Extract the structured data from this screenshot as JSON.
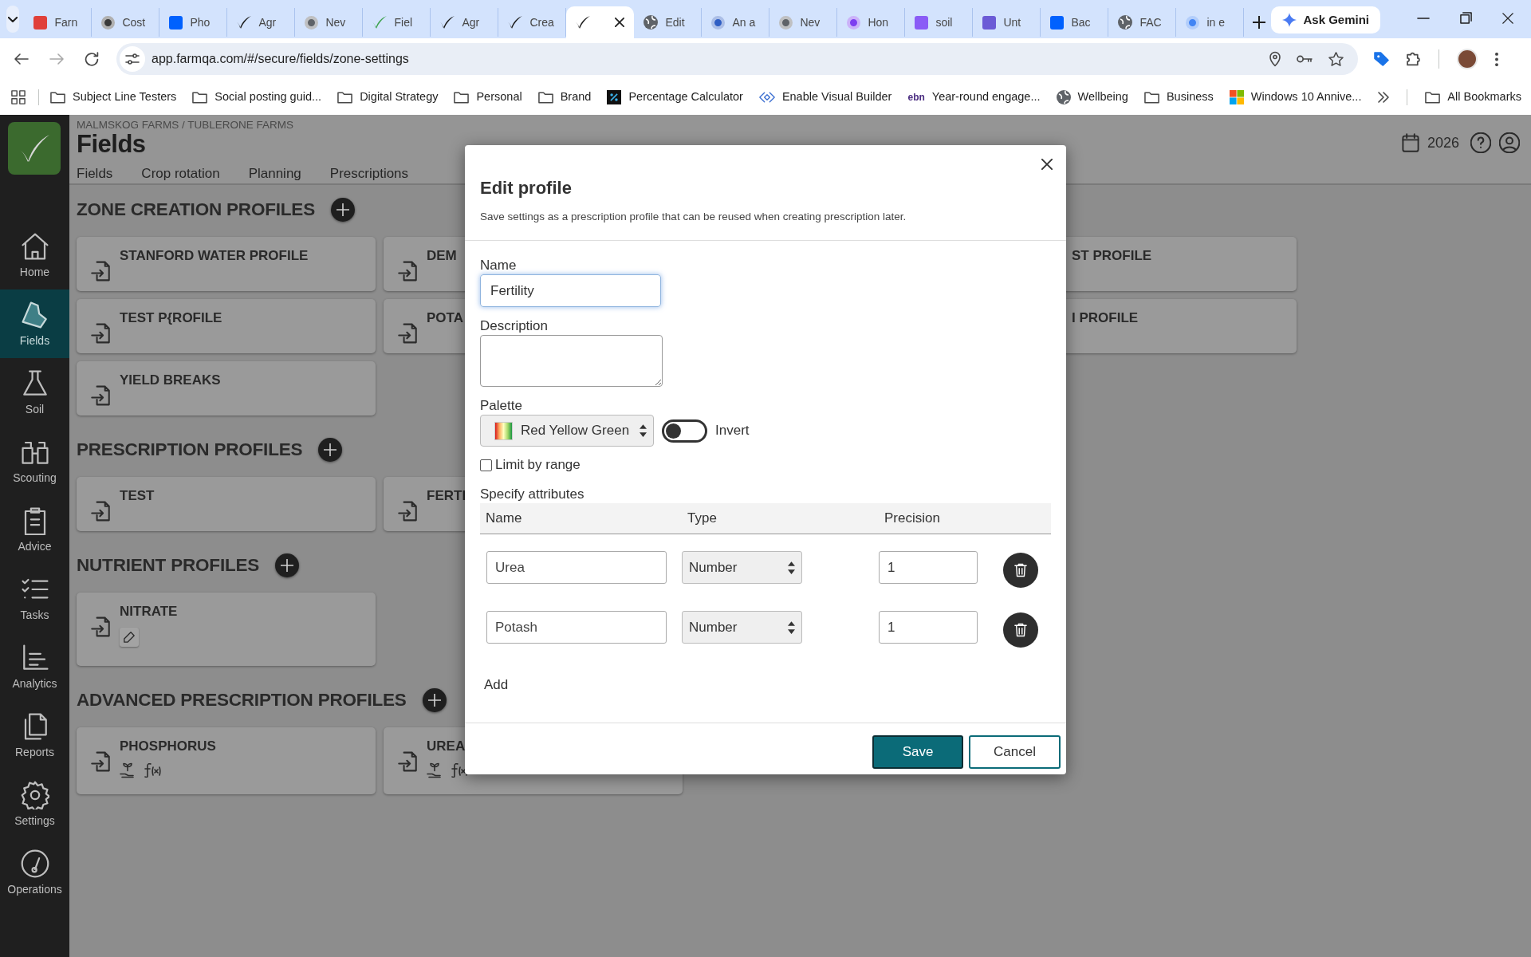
{
  "browser": {
    "tabs": [
      {
        "title": "Farn",
        "selected": false
      },
      {
        "title": "Cost",
        "selected": false
      },
      {
        "title": "Pho",
        "selected": false
      },
      {
        "title": "Agr",
        "selected": false
      },
      {
        "title": "Nev",
        "selected": false
      },
      {
        "title": "Fiel",
        "selected": false
      },
      {
        "title": "Agr",
        "selected": false
      },
      {
        "title": "Crea",
        "selected": false
      },
      {
        "selected": true
      },
      {
        "title": "Edit",
        "selected": false
      },
      {
        "title": "An a",
        "selected": false
      },
      {
        "title": "Nev",
        "selected": false
      },
      {
        "title": "Hon",
        "selected": false
      },
      {
        "title": "soil",
        "selected": false
      },
      {
        "title": "Unt",
        "selected": false
      },
      {
        "title": "Bac",
        "selected": false
      },
      {
        "title": "FAC",
        "selected": false
      },
      {
        "title": "in e",
        "selected": false
      }
    ],
    "gemini": "Ask Gemini",
    "url": "app.farmqa.com/#/secure/fields/zone-settings",
    "bookmarks": [
      {
        "label": "Subject Line Testers"
      },
      {
        "label": "Social posting guid..."
      },
      {
        "label": "Digital Strategy"
      },
      {
        "label": "Personal"
      },
      {
        "label": "Brand"
      },
      {
        "label": "Percentage Calculator"
      },
      {
        "label": "Enable Visual Builder"
      },
      {
        "label": "Year-round engage...",
        "logo_text": "ebn"
      },
      {
        "label": "Wellbeing"
      },
      {
        "label": "Business"
      },
      {
        "label": "Windows 10 Annive..."
      }
    ],
    "all_bookmarks": "All Bookmarks"
  },
  "sidebar": [
    {
      "label": "Home",
      "selected": false
    },
    {
      "label": "Fields",
      "selected": true
    },
    {
      "label": "Soil",
      "selected": false
    },
    {
      "label": "Scouting",
      "selected": false
    },
    {
      "label": "Advice",
      "selected": false
    },
    {
      "label": "Tasks",
      "selected": false
    },
    {
      "label": "Analytics",
      "selected": false
    },
    {
      "label": "Reports",
      "selected": false
    },
    {
      "label": "Settings",
      "selected": false
    },
    {
      "label": "Operations",
      "selected": false
    }
  ],
  "header": {
    "breadcrumb": "MALMSKOG FARMS / TUBLERONE FARMS",
    "title": "Fields",
    "tabs": [
      "Fields",
      "Crop rotation",
      "Planning",
      "Prescriptions"
    ],
    "year": "2026"
  },
  "sections": [
    {
      "title": "ZONE CREATION PROFILES",
      "cards": [
        {
          "label": "STANFORD WATER PROFILE",
          "kind": "full"
        },
        {
          "label": "DEM",
          "kind": "cut_right"
        },
        {
          "label": "ST PROFILE",
          "kind": "cut_left"
        },
        {
          "label": "TEST P{ROFILE",
          "kind": "full"
        },
        {
          "label": "POTA",
          "kind": "cut_right"
        },
        {
          "label": "I PROFILE",
          "kind": "cut_left"
        },
        {
          "label": "YIELD BREAKS",
          "kind": "full"
        }
      ]
    },
    {
      "title": "PRESCRIPTION PROFILES",
      "cards": [
        {
          "label": "TEST",
          "kind": "full"
        },
        {
          "label": "FERTI",
          "kind": "cut_right"
        }
      ]
    },
    {
      "title": "NUTRIENT PROFILES",
      "cards": [
        {
          "label": "NITRATE",
          "kind": "full"
        }
      ]
    },
    {
      "title": "ADVANCED PRESCRIPTION PROFILES",
      "cards": [
        {
          "label": "PHOSPHORUS",
          "kind": "full"
        },
        {
          "label": "UREA",
          "kind": "cut_right"
        }
      ]
    }
  ],
  "dialog": {
    "title": "Edit profile",
    "subtitle": "Save settings as a prescription profile that can be reused when creating prescription later.",
    "name_label": "Name",
    "name_value": "Fertility",
    "name_focused": true,
    "description_label": "Description",
    "palette_label": "Palette",
    "palette_value": "Red Yellow Green",
    "invert": {
      "label": "Invert",
      "on": false
    },
    "limit_by_range": {
      "label": "Limit by range",
      "checked": false
    },
    "attributes_label": "Specify attributes",
    "columns": [
      "Name",
      "Type",
      "Precision"
    ],
    "attributes": [
      {
        "name": "Urea",
        "type": "Number",
        "precision": "1"
      },
      {
        "name": "Potash",
        "type": "Number",
        "precision": "1"
      }
    ],
    "add": "Add",
    "save": "Save",
    "cancel": "Cancel"
  }
}
